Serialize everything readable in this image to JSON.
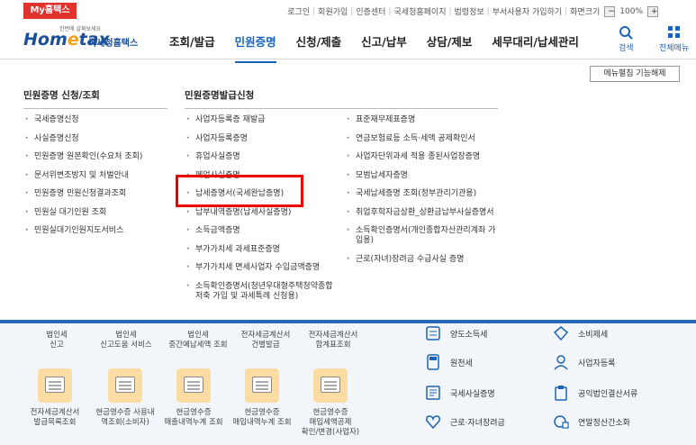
{
  "topbar": {
    "my_tab": "My홈택스",
    "links": [
      "로그인",
      "회원가입",
      "인증센터",
      "국세청홈페이지",
      "법령정보",
      "부서사용자 가입하기",
      "화면크기"
    ],
    "zoom_minus": "−",
    "zoom_value": "100%",
    "zoom_plus": "+"
  },
  "header": {
    "logo_small": "한번에 살펴보세요",
    "logo_main_1": "Hom",
    "logo_main_e": "e",
    "logo_main_2": "tax",
    "logo_sub": "국세청홈택스",
    "nav": [
      "조회/발급",
      "민원증명",
      "신청/제출",
      "신고/납부",
      "상담/제보",
      "세무대리/납세관리"
    ],
    "search_label": "검색",
    "all_menu_label": "전체메뉴"
  },
  "menu": {
    "toggle_label": "메뉴펼침 기능해제",
    "col1_title": "민원증명 신청/조회",
    "col1_items": [
      "국세증명신청",
      "사실증명신청",
      "민원증명 원본확인(수요처 조회)",
      "문서위변조방지 및 처벌안내",
      "민원증명 민원신청결과조회",
      "민원실 대기인원 조회",
      "민원실대기인원지도서비스"
    ],
    "col2_title": "민원증명발급신청",
    "col2_items": [
      "사업자등록증 재발급",
      "사업자등록증명",
      "휴업사실증명",
      "폐업사실증명",
      "납세증명서(국세완납증명)",
      "납부내역증명(납세사실증명)",
      "소득금액증명",
      "부가가치세 과세표준증명",
      "부가가치세 면세사업자 수입금액증명",
      "소득확인증명서(청년우대형주택청약종합저축 가입 및 과세특례 신청용)"
    ],
    "col3_items": [
      "표준재무제표증명",
      "연금보험료등 소득·세액 공제확인서",
      "사업자단위과세 적용 종된사업장증명",
      "모범납세자증명",
      "국세납세증명 조회(정부관리기관용)",
      "취업후학자금상환_상환금납부사실증명서",
      "소득확인증명서(개인종합자산관리계좌 가입용)",
      "근로(자녀)장려금 수급사실 증명"
    ]
  },
  "bottom": {
    "top_row": [
      {
        "line1": "법인세",
        "line2": "신고"
      },
      {
        "line1": "법인세",
        "line2": "신고도움 서비스"
      },
      {
        "line1": "법인세",
        "line2": "중간예납세액 조회"
      },
      {
        "line1": "전자세금계산서",
        "line2": "건별발급"
      },
      {
        "line1": "전자세금계산서",
        "line2": "합계표조회"
      }
    ],
    "tiles": [
      {
        "line1": "전자세금계산서",
        "line2": "발급목록조회",
        "line3": ""
      },
      {
        "line1": "현금영수증 사용내",
        "line2": "역조회(소비자)",
        "line3": ""
      },
      {
        "line1": "현금영수증",
        "line2": "매출내역누계 조회",
        "line3": ""
      },
      {
        "line1": "현금영수증",
        "line2": "매입내역누계 조회",
        "line3": ""
      },
      {
        "line1": "현금영수증",
        "line2": "매입세액공제",
        "line3": "확인/변경(사업자)"
      }
    ],
    "right_items": [
      "양도소득세",
      "소비제세",
      "원천세",
      "사업자등록",
      "국세사실증명",
      "공익법인결산서류",
      "근로·자녀장려금",
      "연말정산간소화"
    ]
  }
}
